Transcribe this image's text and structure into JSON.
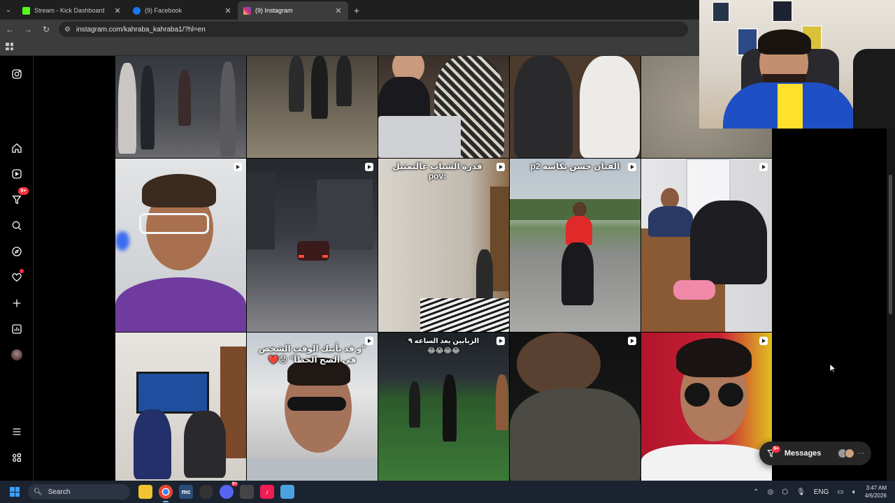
{
  "browser": {
    "tabs": [
      {
        "title": "Stream - Kick Dashboard",
        "favicon_color": "#53fc18",
        "active": false
      },
      {
        "title": "(9) Facebook",
        "favicon_color": "#1877f2",
        "active": false
      },
      {
        "title": "(9) Instagram",
        "favicon_color": "#e1306c",
        "active": true
      }
    ],
    "new_tab_symbol": "+",
    "url": "instagram.com/kahraba_kahraba1/?hl=en"
  },
  "instagram": {
    "nav": {
      "notifications_badge": "9+",
      "items": [
        "instagram-logo",
        "home",
        "reels",
        "notifications",
        "search",
        "explore",
        "activity",
        "create",
        "dashboard",
        "profile",
        "more",
        "also-from-meta"
      ]
    },
    "grid": {
      "captions": {
        "r2c3": "قدرة الشباب عالتمثيل :pov",
        "r2c4": "الفنان حسن بكاسه p2",
        "r3c2_line1": "\"و قد يأتيك الوقت الشخص",
        "r3c2_line2": "في الصح الخطأ\" 😞❤️",
        "r3c3_line1": "الزبابين بعد الساعه ٩",
        "r3c3_line2": "😂😂😂😂"
      }
    },
    "messages": {
      "label": "Messages",
      "badge": "9+"
    }
  },
  "taskbar": {
    "search_placeholder": "Search",
    "language": "ENG",
    "time": "3:47 AM",
    "date": "4/6/2026",
    "discord_badge": "9+"
  },
  "colors": {
    "accent_red": "#ff3040",
    "ig_background": "#000000",
    "taskbar": "#1c2330"
  }
}
